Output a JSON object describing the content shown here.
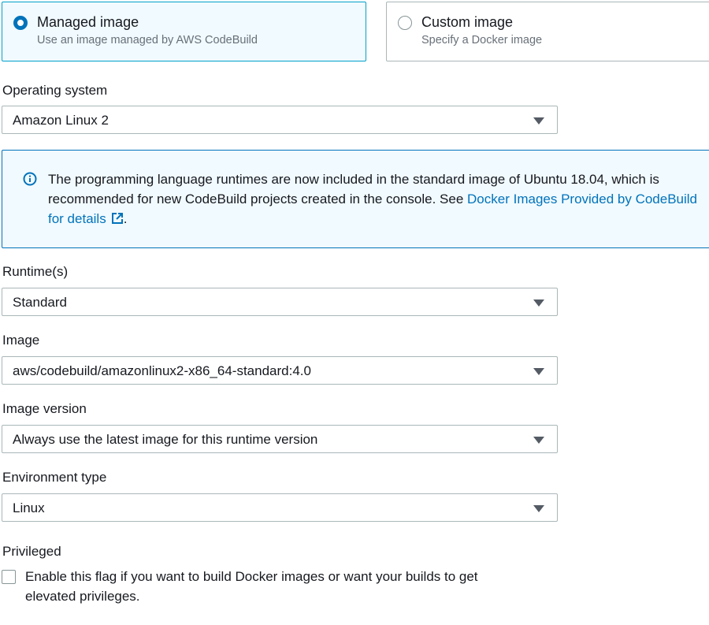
{
  "image_source": {
    "managed": {
      "title": "Managed image",
      "description": "Use an image managed by AWS CodeBuild",
      "selected": true
    },
    "custom": {
      "title": "Custom image",
      "description": "Specify a Docker image",
      "selected": false
    }
  },
  "operating_system": {
    "label": "Operating system",
    "value": "Amazon Linux 2"
  },
  "alert": {
    "text_line1": "The programming language runtimes are now included in the standard image of Ubuntu 18.04, which is",
    "text_line2": "recommended for new CodeBuild projects created in the console. See ",
    "link_part1": "Docker Images Provided by CodeBuild",
    "link_part2": "for details",
    "text_end": ".",
    "info_icon": "info-icon",
    "external_icon": "external-link-icon",
    "color": "#0073bb"
  },
  "runtime": {
    "label": "Runtime(s)",
    "value": "Standard"
  },
  "image": {
    "label": "Image",
    "value": "aws/codebuild/amazonlinux2-x86_64-standard:4.0"
  },
  "image_version": {
    "label": "Image version",
    "value": "Always use the latest image for this runtime version"
  },
  "environment_type": {
    "label": "Environment type",
    "value": "Linux"
  },
  "privileged": {
    "label": "Privileged",
    "checkbox_text": "Enable this flag if you want to build Docker images or want your builds to get elevated privileges.",
    "checked": false
  }
}
